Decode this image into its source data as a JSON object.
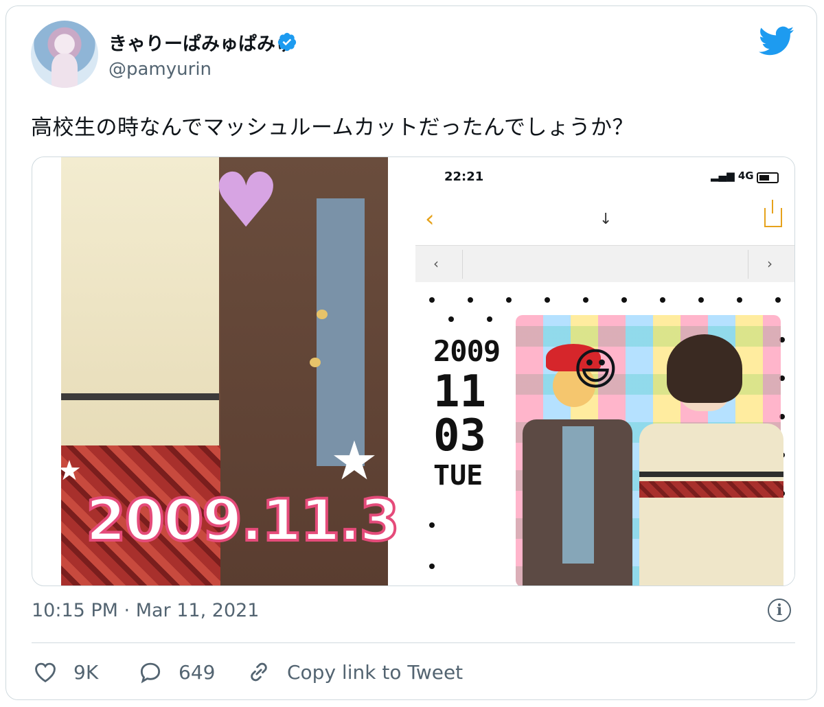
{
  "user": {
    "display_name": "きゃりーぱみゅぱみゅ",
    "handle": "@pamyurin",
    "verified": true
  },
  "tweet": {
    "text": "高校生の時なんでマッシュルームカットだったんでしょうか？",
    "timestamp": "10:15 PM · Mar 11, 2021"
  },
  "media": {
    "left_photo_stamp": "2009.11.3",
    "phone_status_time": "22:21",
    "phone_network": "4G",
    "print_date": {
      "year": "2009",
      "month": "11",
      "day": "03",
      "weekday": "TUE"
    }
  },
  "actions": {
    "likes": "9K",
    "replies": "649",
    "copy_link_label": "Copy link to Tweet"
  },
  "colors": {
    "twitter_blue": "#1d9bf0",
    "text_secondary": "#536471",
    "border": "#cfd9de"
  },
  "icons": [
    "twitter-bird-icon",
    "verified-badge-icon",
    "info-icon",
    "heart-icon",
    "reply-bubble-icon",
    "link-icon"
  ]
}
